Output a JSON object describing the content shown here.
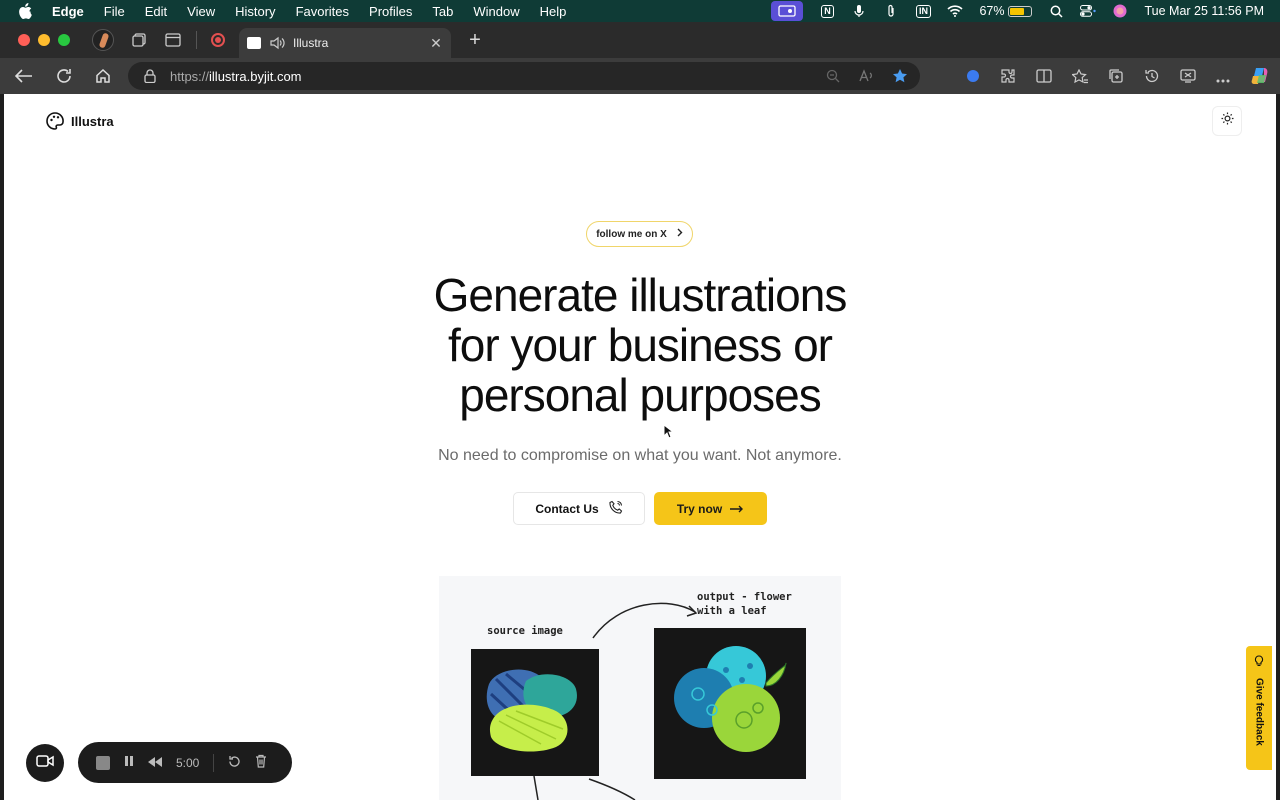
{
  "menubar": {
    "app_name": "Edge",
    "menus": [
      "File",
      "Edit",
      "View",
      "History",
      "Favorites",
      "Profiles",
      "Tab",
      "Window",
      "Help"
    ],
    "battery_percent": "67%",
    "battery_level": 0.67,
    "datetime": "Tue Mar 25  11:56 PM"
  },
  "browser": {
    "tab_title": "Illustra",
    "url_scheme": "https://",
    "url_host": "illustra.byjit.com"
  },
  "page": {
    "brand": "Illustra",
    "follow_label": "follow me on X",
    "headline_line1": "Generate illustrations",
    "headline_line2": "for your business or",
    "headline_line3": "personal purposes",
    "subheadline": "No need to compromise on what you want. Not anymore.",
    "contact_label": "Contact Us",
    "try_label": "Try now",
    "illustration": {
      "source_label": "source image",
      "output_label_line1": "output - flower",
      "output_label_line2": "with a leaf"
    },
    "feedback_label": "Give feedback"
  },
  "recorder": {
    "time": "5:00"
  },
  "colors": {
    "accent_yellow": "#f5c518",
    "menubar_bg": "#0f3b36",
    "text_dark": "#0d0d0d"
  }
}
